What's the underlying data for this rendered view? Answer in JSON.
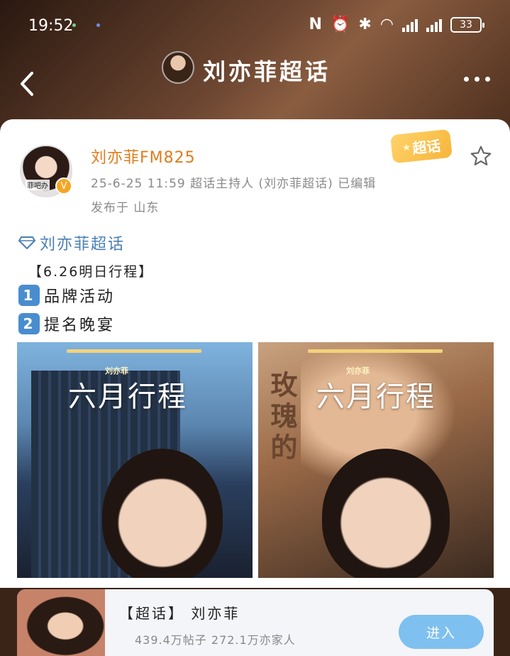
{
  "status_bar": {
    "time": "19:52",
    "battery": "33"
  },
  "nav": {
    "title": "刘亦菲超话"
  },
  "post": {
    "author_name": "刘亦菲FM825",
    "avatar_tag": "菲吧办",
    "meta": "25-6-25 11:59  超话主持人 (刘亦菲超话)  已编辑",
    "location": "发布于 山东",
    "badge_label": "超话",
    "topic_link": "刘亦菲超话",
    "body_heading": "【6.26明日行程】",
    "items": [
      {
        "num": "1",
        "text": "品牌活动"
      },
      {
        "num": "2",
        "text": "提名晚宴"
      }
    ],
    "images": [
      {
        "poster_title": "六月行程",
        "tag": "刘亦菲"
      },
      {
        "poster_title": "六月行程",
        "tag": "刘亦菲",
        "vertical": "玫瑰的"
      }
    ]
  },
  "topic_card": {
    "title": "【超话】 刘亦菲",
    "stats": "439.4万帖子 272.1万亦家人",
    "enter_label": "进入"
  },
  "colors": {
    "accent_orange": "#e07c1a",
    "link_blue": "#4a7fb5",
    "enter_button": "#7ec0ef",
    "number_badge": "#4a8dcf"
  }
}
